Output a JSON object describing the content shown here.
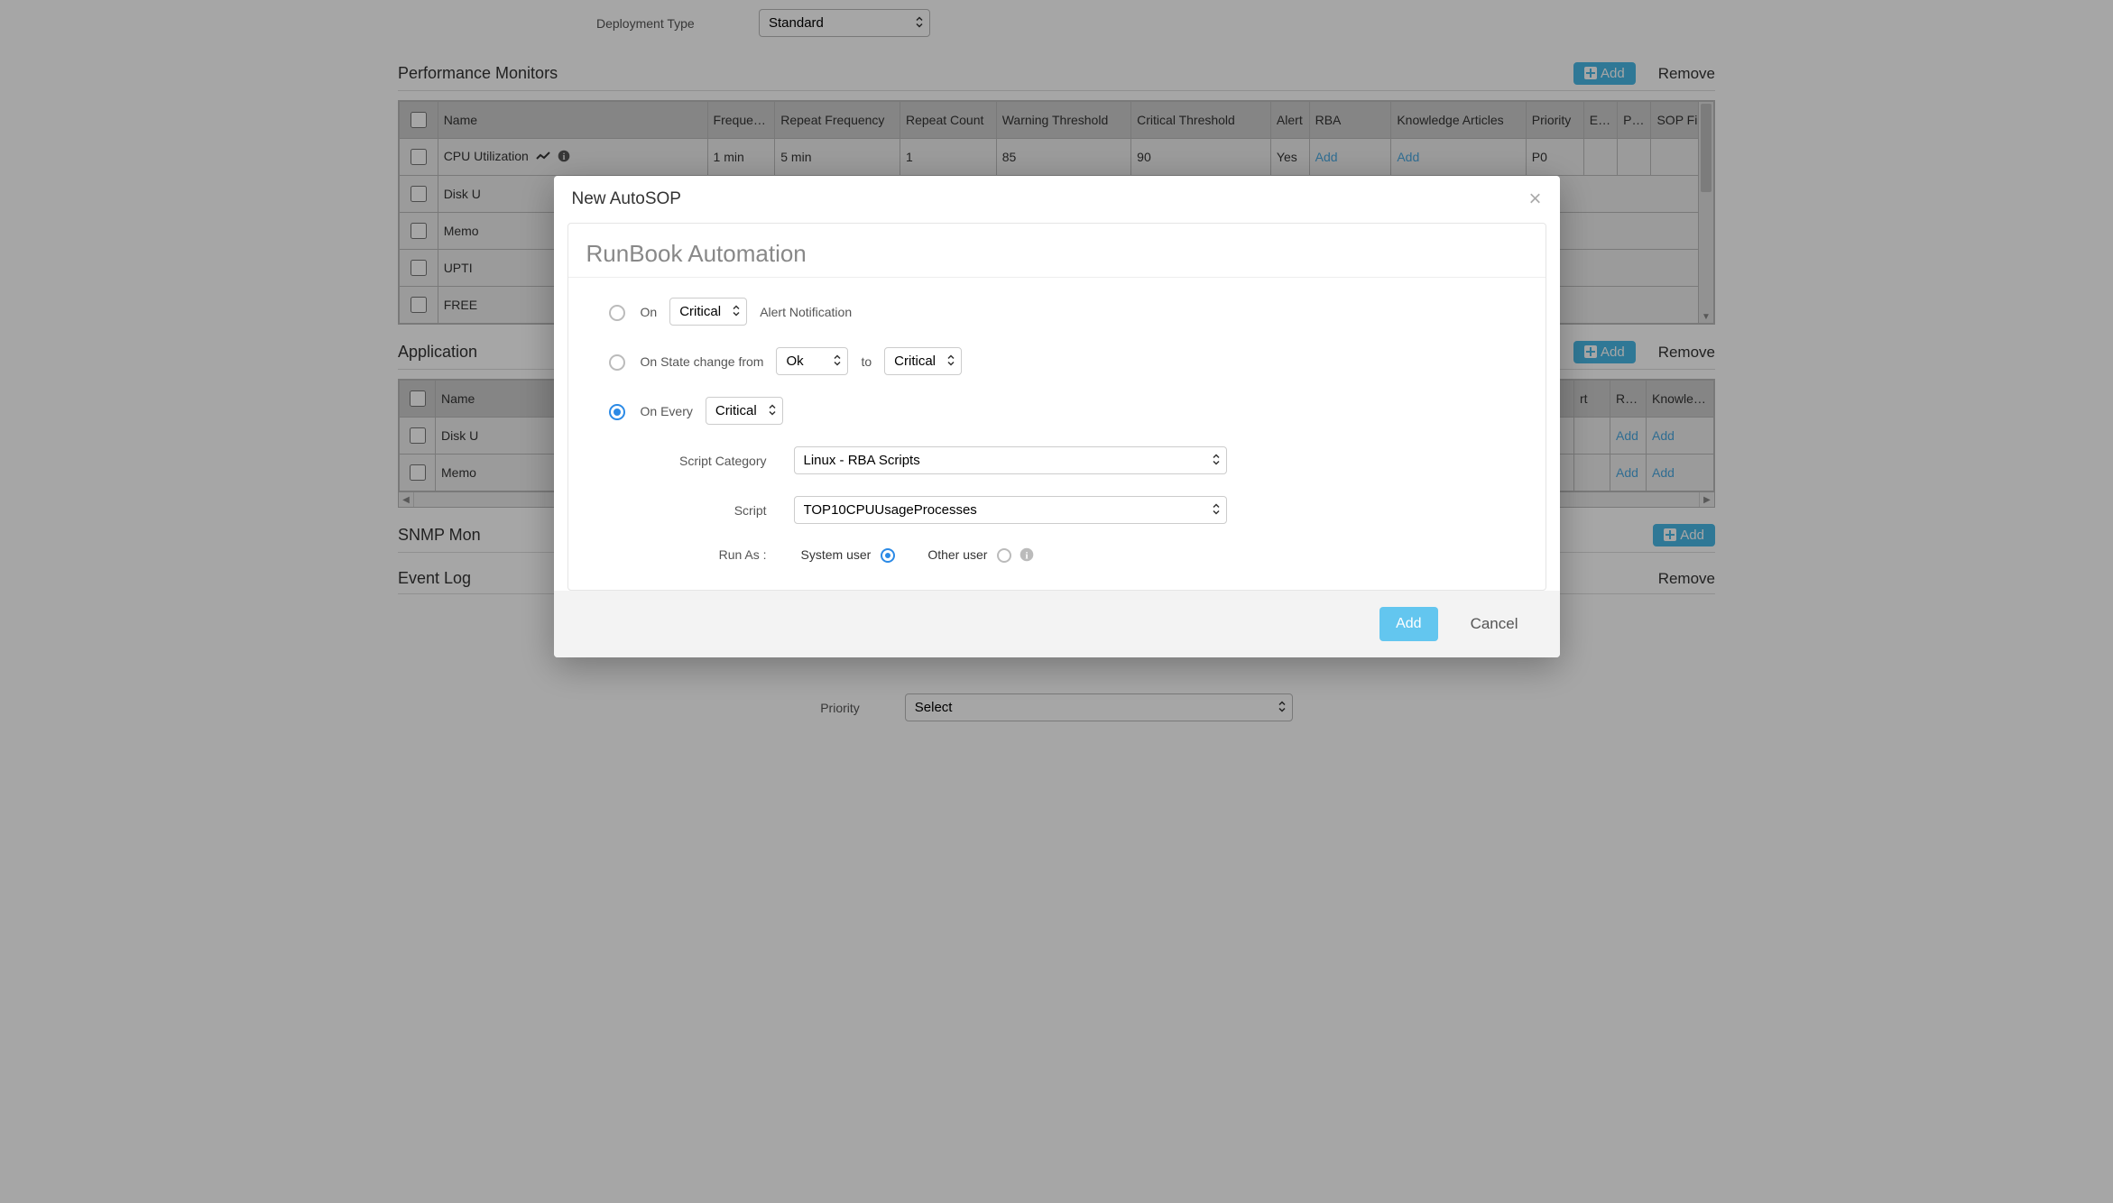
{
  "deployment": {
    "label": "Deployment Type",
    "value": "Standard"
  },
  "sections": {
    "perf": {
      "title": "Performance Monitors",
      "columns": [
        "Name",
        "Frequency",
        "Repeat Frequency",
        "Repeat Count",
        "Warning Threshold",
        "Critical Threshold",
        "Alert",
        "RBA",
        "Knowledge Articles",
        "Priority",
        "E…",
        "Ph…",
        "SOP File"
      ],
      "rows": [
        {
          "name": "CPU Utilization",
          "freq": "1 min",
          "rfreq": "5 min",
          "rcnt": "1",
          "warn": "85",
          "crit": "90",
          "alert": "Yes",
          "rba": "Add",
          "ka": "Add",
          "prio": "P0",
          "em": "",
          "ph": "",
          "sop": ""
        },
        {
          "name": "Disk U"
        },
        {
          "name": "Memo"
        },
        {
          "name": "UPTI"
        },
        {
          "name": "FREE"
        }
      ]
    },
    "app": {
      "title": "Application",
      "columns_vis": [
        "Name",
        "rt",
        "RBA",
        "Knowledge"
      ],
      "rows": [
        {
          "name": "Disk U",
          "rt": "",
          "rba": "Add",
          "ka": "Add"
        },
        {
          "name": "Memo",
          "rt": "",
          "rba": "Add",
          "ka": "Add"
        }
      ]
    },
    "snmp": {
      "title": "SNMP Mon"
    },
    "eventlog": {
      "title": "Event Log"
    }
  },
  "buttons": {
    "add": "Add",
    "remove": "Remove"
  },
  "priority_footer": {
    "label": "Priority",
    "value": "Select"
  },
  "modal": {
    "title": "New AutoSOP",
    "card_title": "RunBook Automation",
    "on_label": "On",
    "on_value": "Critical",
    "on_suffix": "Alert Notification",
    "state_label": "On State change from",
    "state_from": "Ok",
    "state_to_word": "to",
    "state_to": "Critical",
    "every_label": "On Every",
    "every_value": "Critical",
    "category_label": "Script Category",
    "category_value": "Linux - RBA Scripts",
    "script_label": "Script",
    "script_value": "TOP10CPUUsageProcesses",
    "runas_label": "Run As :",
    "runas_system": "System user",
    "runas_other": "Other user",
    "footer_add": "Add",
    "footer_cancel": "Cancel"
  }
}
